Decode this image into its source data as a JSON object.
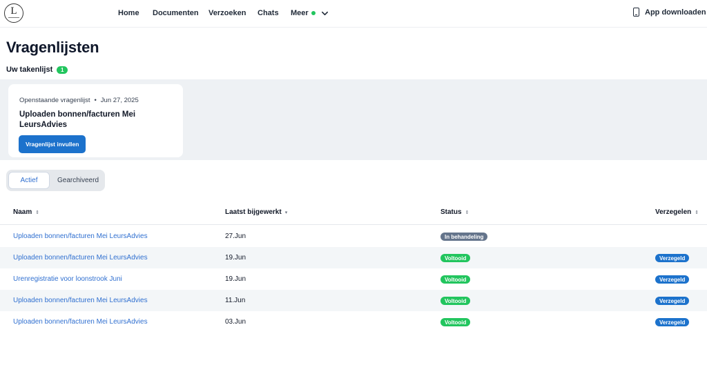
{
  "header": {
    "logo_letter": "L",
    "nav": [
      {
        "label": "Home"
      },
      {
        "label": "Documenten"
      },
      {
        "label": "Verzoeken"
      },
      {
        "label": "Chats"
      },
      {
        "label": "Meer"
      }
    ],
    "app_download": "App downloaden"
  },
  "page": {
    "title": "Vragenlijsten",
    "tasks_label": "Uw takenlijst",
    "tasks_count": "1"
  },
  "task": {
    "type": "Openstaande vragenlijst",
    "date": "Jun 27, 2025",
    "title": "Uploaden bonnen/facturen Mei LeursAdvies",
    "button": "Vragenlijst invullen"
  },
  "tabs": [
    {
      "label": "Actief",
      "active": true
    },
    {
      "label": "Gearchiveerd",
      "active": false
    }
  ],
  "table": {
    "columns": [
      "Naam",
      "Laatst bijgewerkt",
      "Status",
      "Verzegelen"
    ],
    "rows": [
      {
        "name": "Uploaden bonnen/facturen Mei LeursAdvies",
        "updated": "27.Jun",
        "status": "In behandeling",
        "status_color": "#64748b",
        "sealed": ""
      },
      {
        "name": "Uploaden bonnen/facturen Mei LeursAdvies",
        "updated": "19.Jun",
        "status": "Voltooid",
        "status_color": "#22c55e",
        "sealed": "Verzegeld"
      },
      {
        "name": "Urenregistratie voor loonstrook Juni",
        "updated": "19.Jun",
        "status": "Voltooid",
        "status_color": "#22c55e",
        "sealed": "Verzegeld"
      },
      {
        "name": "Uploaden bonnen/facturen Mei LeursAdvies",
        "updated": "11.Jun",
        "status": "Voltooid",
        "status_color": "#22c55e",
        "sealed": "Verzegeld"
      },
      {
        "name": "Uploaden bonnen/facturen Mei LeursAdvies",
        "updated": "03.Jun",
        "status": "Voltooid",
        "status_color": "#22c55e",
        "sealed": "Verzegeld"
      }
    ]
  },
  "colors": {
    "primary": "#1c72cc",
    "link": "#2f6fd0",
    "success": "#22c55e",
    "muted_status": "#64748b"
  },
  "icons": {
    "nav_dot": "status-dot",
    "meer_chevron": "chevron-down-icon",
    "app_download": "phone-icon",
    "sort": "sort-icon"
  }
}
